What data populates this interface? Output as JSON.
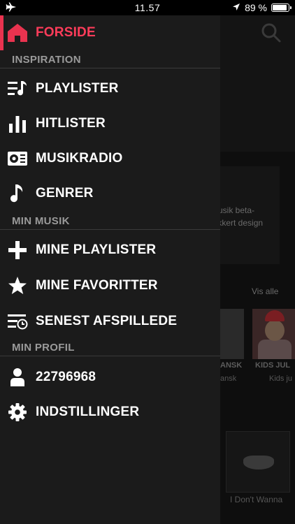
{
  "status_bar": {
    "time": "11.57",
    "battery": "89 %",
    "battery_level": 0.89
  },
  "background": {
    "card_text_line1": "Musik beta-",
    "card_text_line2": "lekkert design",
    "show_all": "Vis alle",
    "tile_label_1": "ANSK",
    "tile_sub_1": "ansk",
    "tile_label_2": "KIDS JUL",
    "tile_sub_2": "Kids ju",
    "album_title": "I Don't Wanna"
  },
  "menu": {
    "home": "FORSIDE",
    "sections": {
      "inspiration": "INSPIRATION",
      "my_music": "MIN MUSIK",
      "my_profile": "MIN PROFIL"
    },
    "items": {
      "playlists": "PLAYLISTER",
      "charts": "HITLISTER",
      "radio": "MUSIKRADIO",
      "genres": "GENRER",
      "my_playlists": "MINE PLAYLISTER",
      "favorites": "MINE FAVORITTER",
      "recent": "SENEST AFSPILLEDE",
      "profile": "22796968",
      "settings": "INDSTILLINGER"
    }
  },
  "colors": {
    "accent": "#e9334f",
    "drawer_bg": "#1b1b1b",
    "section_text": "#9a9a9a"
  }
}
